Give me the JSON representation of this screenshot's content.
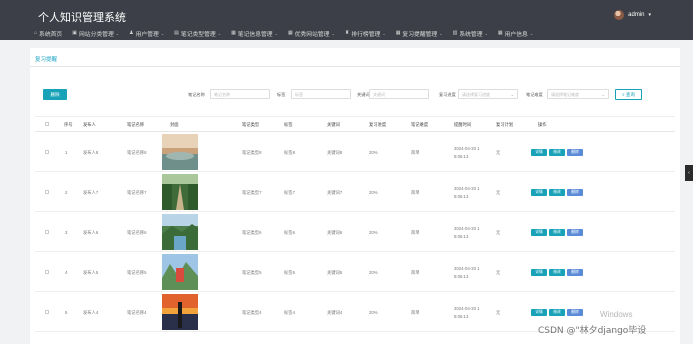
{
  "app": {
    "title": "个人知识管理系统",
    "user": "admin"
  },
  "nav": [
    {
      "icon": "house-icon",
      "glyph": "⌂",
      "label": "系统首页",
      "chev": ""
    },
    {
      "icon": "globe-icon",
      "glyph": "▣",
      "label": "网站分类管理",
      "chev": "⌄"
    },
    {
      "icon": "user-icon",
      "glyph": "♟",
      "label": "用户管理",
      "chev": "⌄"
    },
    {
      "icon": "note-icon",
      "glyph": "▤",
      "label": "笔记类型管理",
      "chev": "⌄"
    },
    {
      "icon": "notebook-icon",
      "glyph": "▦",
      "label": "笔记信息管理",
      "chev": "⌄"
    },
    {
      "icon": "star-icon",
      "glyph": "▦",
      "label": "优秀网站管理",
      "chev": "⌄"
    },
    {
      "icon": "ranking-icon",
      "glyph": "♜",
      "label": "排行榜管理",
      "chev": "⌄"
    },
    {
      "icon": "review-icon",
      "glyph": "▦",
      "label": "复习提醒管理",
      "chev": "⌄"
    },
    {
      "icon": "system-icon",
      "glyph": "▥",
      "label": "系统管理",
      "chev": "⌄"
    },
    {
      "icon": "userinfo-icon",
      "glyph": "▦",
      "label": "用户信息",
      "chev": "⌄"
    }
  ],
  "breadcrumb": "复习提醒",
  "toolbar": {
    "delete": "删除",
    "search": "查询",
    "search_icon": "search-icon"
  },
  "filters": {
    "note_name": {
      "label": "笔记名称",
      "placeholder": "笔记名称"
    },
    "tag": {
      "label": "标签",
      "placeholder": "标签"
    },
    "keyword": {
      "label": "关键词",
      "placeholder": "关键词"
    },
    "review_progress": {
      "label": "复习进度",
      "placeholder": "请选择复习进度"
    },
    "note_difficulty": {
      "label": "笔记难度",
      "placeholder": "请选择笔记难度"
    }
  },
  "columns": [
    "序号",
    "发布人",
    "笔记名称",
    "封面",
    "笔记类型",
    "标签",
    "关键词",
    "复习进度",
    "笔记难度",
    "提醒时间",
    "复习计划",
    "操作"
  ],
  "actions": {
    "detail": "详情",
    "edit": "修改",
    "remove": "删除"
  },
  "rows": [
    {
      "no": "1",
      "publisher": "发布人8",
      "name": "笔记名称8",
      "type": "笔记类型8",
      "tag": "标签8",
      "keyword": "关键词8",
      "progress": "20%",
      "difficulty": "简单",
      "date": "2024-04-20 1",
      "time": "9:06:13",
      "plan": "无"
    },
    {
      "no": "2",
      "publisher": "发布人7",
      "name": "笔记名称7",
      "type": "笔记类型7",
      "tag": "标签7",
      "keyword": "关键词7",
      "progress": "20%",
      "difficulty": "简单",
      "date": "2024-04-20 1",
      "time": "9:06:13",
      "plan": "无"
    },
    {
      "no": "3",
      "publisher": "发布人6",
      "name": "笔记名称6",
      "type": "笔记类型6",
      "tag": "标签6",
      "keyword": "关键词6",
      "progress": "20%",
      "difficulty": "简单",
      "date": "2024-04-20 1",
      "time": "9:06:13",
      "plan": "无"
    },
    {
      "no": "4",
      "publisher": "发布人5",
      "name": "笔记名称5",
      "type": "笔记类型5",
      "tag": "标签5",
      "keyword": "关键词5",
      "progress": "20%",
      "difficulty": "简单",
      "date": "2024-04-20 1",
      "time": "9:06:13",
      "plan": "无"
    },
    {
      "no": "5",
      "publisher": "发布人4",
      "name": "笔记名称4",
      "type": "笔记类型4",
      "tag": "标签4",
      "keyword": "关键词4",
      "progress": "20%",
      "difficulty": "简单",
      "date": "2024-04-20 1",
      "time": "9:06:13",
      "plan": "无"
    }
  ],
  "watermark": {
    "windows": "Windows",
    "csdn": "CSDN @\"林夕django毕设"
  },
  "side_tab": "‹"
}
